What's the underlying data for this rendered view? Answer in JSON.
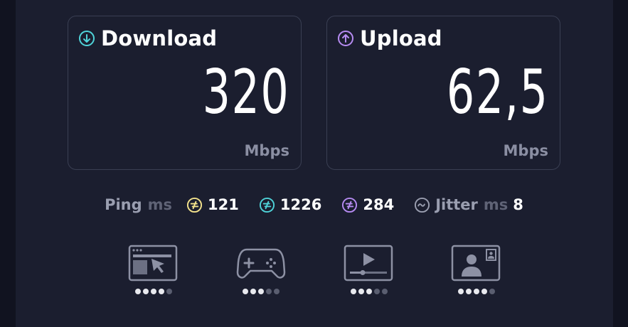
{
  "download": {
    "title": "Download",
    "value": "320",
    "unit": "Mbps",
    "icon": "arrow-down-circle-icon",
    "accent": "#4fd3d9"
  },
  "upload": {
    "title": "Upload",
    "value": "62,5",
    "unit": "Mbps",
    "icon": "arrow-up-circle-icon",
    "accent": "#b68bf2"
  },
  "ping": {
    "label": "Ping",
    "unit": "ms",
    "values": [
      {
        "value": "121",
        "color": "#f4e38c"
      },
      {
        "value": "1226",
        "color": "#4fd3d9"
      },
      {
        "value": "284",
        "color": "#b68bf2"
      }
    ]
  },
  "jitter": {
    "label": "Jitter",
    "unit": "ms",
    "value": "8"
  },
  "apps": [
    {
      "icon": "web-browsing-icon",
      "rating": 4,
      "max": 5
    },
    {
      "icon": "gaming-controller-icon",
      "rating": 3,
      "max": 5
    },
    {
      "icon": "video-streaming-icon",
      "rating": 3,
      "max": 5
    },
    {
      "icon": "video-call-icon",
      "rating": 4,
      "max": 5
    }
  ]
}
